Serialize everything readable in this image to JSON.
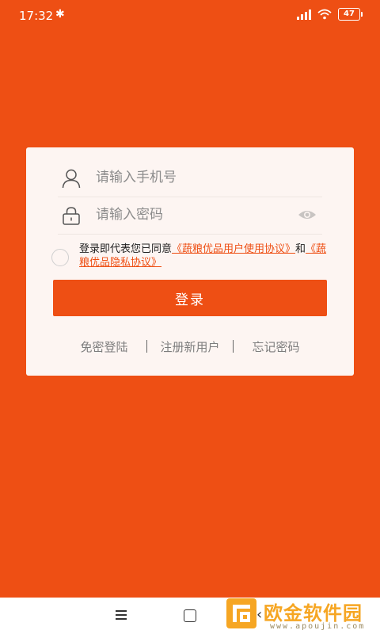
{
  "status_bar": {
    "time": "17:32",
    "battery": "47"
  },
  "login": {
    "phone_placeholder": "请输入手机号",
    "password_placeholder": "请输入密码",
    "agreement_prefix": "登录即代表您已同意",
    "user_agreement_link": "《蔬粮优品用户使用协议》",
    "agreement_and": "和",
    "privacy_link": "《蔬粮优品隐私协议》",
    "login_button": "登录"
  },
  "links": {
    "passwordless": "免密登陆",
    "register": "注册新用户",
    "forgot": "忘记密码"
  },
  "watermark": {
    "title": "欧金软件园",
    "subtitle": "www.apoujin.com"
  },
  "colors": {
    "brand": "#ee4f14",
    "card_bg": "#fdf5f2",
    "watermark": "#f6a623"
  },
  "icons": [
    "bluetooth-icon",
    "signal-icon",
    "wifi-icon",
    "battery-icon",
    "user-icon",
    "lock-icon",
    "eye-icon",
    "menu-icon",
    "home-icon",
    "back-icon"
  ]
}
